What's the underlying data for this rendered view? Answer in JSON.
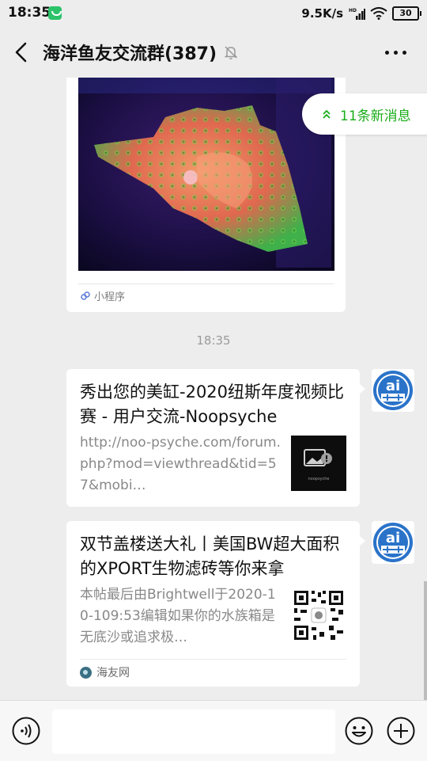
{
  "status_bar": {
    "time": "18:35",
    "network_speed": "9.5K/s",
    "network_type": "HD",
    "battery": "30"
  },
  "header": {
    "title": "海洋鱼友交流群(387)"
  },
  "new_messages": {
    "label": "11条新消息"
  },
  "messages": [
    {
      "type": "mini-program",
      "label": "小程序"
    },
    {
      "type": "timestamp",
      "text": "18:35"
    },
    {
      "type": "link",
      "title": "秀出您的美缸-2020纽斯年度视频比赛 - 用户交流-Noopsyche",
      "description": "http://noo-psyche.com/forum.php?mod=viewthread&tid=57&mobi…",
      "thumbnail_caption": "noopsyche"
    },
    {
      "type": "link",
      "title": "双节盖楼送大礼丨美国BW超大面积的XPORT生物滤砖等你来拿",
      "description": "本帖最后由Brightwell于2020-10-109:53编辑如果你的水族箱是无底沙或追求极…",
      "source": "海友网"
    }
  ],
  "colors": {
    "accent_green": "#1aad19",
    "chat_bg": "#ededed",
    "bubble_bg": "#ffffff"
  }
}
